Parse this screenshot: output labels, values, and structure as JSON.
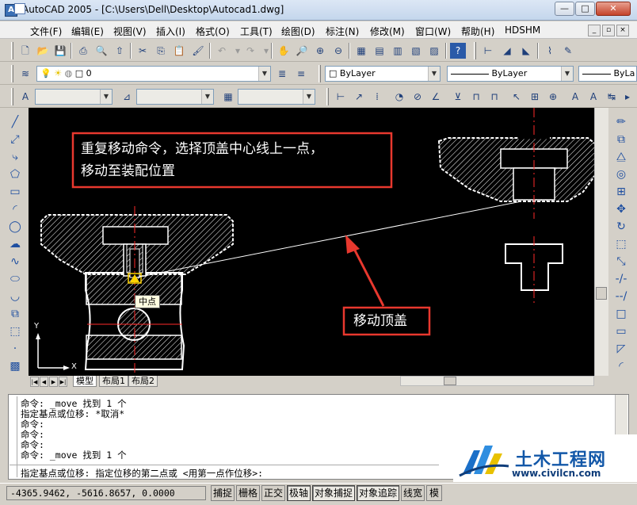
{
  "window": {
    "app_icon": "A",
    "title": "AutoCAD 2005 - [C:\\Users\\Dell\\Desktop\\Autocad1.dwg]",
    "min": "—",
    "max": "□",
    "close": "✕"
  },
  "menu": {
    "items": [
      "文件(F)",
      "编辑(E)",
      "视图(V)",
      "插入(I)",
      "格式(O)",
      "工具(T)",
      "绘图(D)",
      "标注(N)",
      "修改(M)",
      "窗口(W)",
      "帮助(H)",
      "HDSHM"
    ],
    "mdi_min": "_",
    "mdi_restore": "▫",
    "mdi_close": "×"
  },
  "layers": {
    "current_layer": "0",
    "color": "ByLayer",
    "linetype": "ByLayer",
    "lineweight": "ByLa"
  },
  "drawing": {
    "annotation_main_line1": "重复移动命令，选择顶盖中心线上一点，",
    "annotation_main_line2": "移动至装配位置",
    "annotation_move": "移动顶盖",
    "midpoint_tooltip": "中点",
    "ucs_x": "X",
    "ucs_y": "Y",
    "annotation_color": "#e8382e"
  },
  "tabs": {
    "items": [
      "模型",
      "布局1",
      "布局2"
    ],
    "active": "模型",
    "nav": [
      "|◀",
      "◀",
      "▶",
      "▶|"
    ]
  },
  "command": {
    "lines": [
      "命令: _move 找到 1 个",
      "指定基点或位移: *取消*",
      "命令:",
      "命令:",
      "命令:",
      "命令: _move 找到 1 个"
    ],
    "prompt": "指定基点或位移: 指定位移的第二点或 <用第一点作位移>:"
  },
  "status": {
    "coords": "-4365.9462, -5616.8657, 0.0000",
    "buttons": [
      "捕捉",
      "栅格",
      "正交",
      "极轴",
      "对象捕捉",
      "对象追踪",
      "线宽",
      "模"
    ]
  },
  "watermark": {
    "brand": "土木工程网",
    "url": "www.civilcn.com"
  }
}
